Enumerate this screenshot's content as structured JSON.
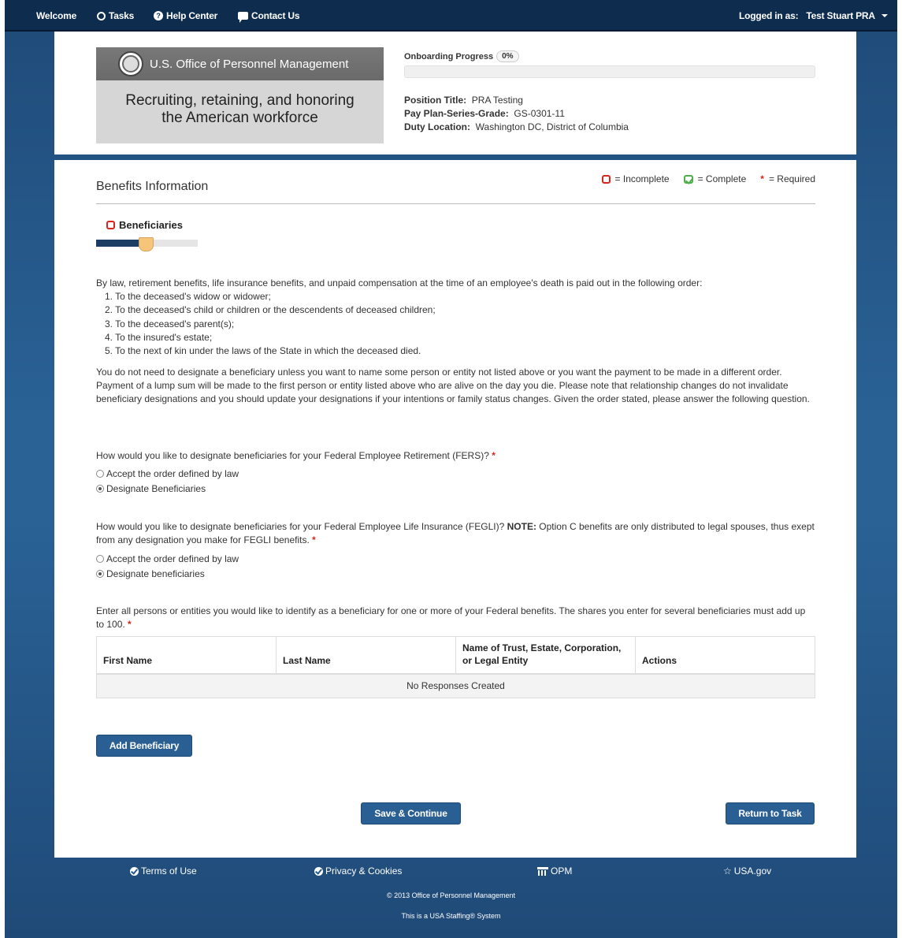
{
  "nav": {
    "welcome": "Welcome",
    "tasks": "Tasks",
    "help_center": "Help Center",
    "contact_us": "Contact Us",
    "logged_in_label": "Logged in as:",
    "user_name": "Test Stuart PRA"
  },
  "header": {
    "org_name": "U.S. Office of Personnel Management",
    "tagline_line1": "Recruiting, retaining, and honoring",
    "tagline_line2": "the American workforce",
    "progress_label": "Onboarding Progress",
    "progress_badge": "0%",
    "progress_value": 0,
    "position_title_label": "Position Title:",
    "position_title": "PRA Testing",
    "pay_plan_label": "Pay Plan-Series-Grade:",
    "pay_plan": "GS-0301-11",
    "duty_location_label": "Duty Location:",
    "duty_location": "Washington DC, District of Columbia"
  },
  "main": {
    "title": "Benefits Information",
    "legend": {
      "incomplete": "= Incomplete",
      "complete": "= Complete",
      "required_star": "*",
      "required": "= Required"
    },
    "section_title": "Beneficiaries",
    "stepper_progress": 0.45,
    "intro": "By law, retirement benefits, life insurance benefits, and unpaid compensation at the time of an employee's death is paid out in the following order:",
    "order": [
      "1. To the deceased's widow or widower;",
      "2. To the deceased's child or children or the descendents of deceased children;",
      "3. To the deceased's parent(s);",
      "4. To the insured's estate;",
      "5. To the next of kin under the laws of the State in which the deceased died."
    ],
    "explanation": "You do not need to designate a beneficiary unless you want to name some person or entity not listed above or you want the payment to be made in a different order. Payment of a lump sum will be made to the first person or entity listed above who are alive on the day you die. Please note that relationship changes do not invalidate beneficiary designations and you should update your designations if your intentions or family status changes. Given the order stated, please answer the following question.",
    "q_fers": "How would you like to designate beneficiaries for your Federal Employee Retirement (FERS)?",
    "q_fers_opt1": "Accept the order defined by law",
    "q_fers_opt2": "Designate Beneficiaries",
    "q_fegli_pre": "How would you like to designate beneficiaries for your Federal Employee Life Insurance (FEGLI)?",
    "q_fegli_note": "NOTE:",
    "q_fegli_post": "Option C benefits are only distributed to legal spouses, thus exept from any designation you make for FEGLI benefits.",
    "q_fegli_opt1": "Accept the order defined by law",
    "q_fegli_opt2": "Designate beneficiaries",
    "q_entries": "Enter all persons or entities you would like to identify as a beneficiary for one or more of your Federal benefits. The shares you enter for several beneficiaries must add up to 100.",
    "required_star": "*",
    "table": {
      "headers": [
        "First Name",
        "Last Name",
        "Name of Trust, Estate, Corporation, or Legal Entity",
        "Actions"
      ],
      "empty": "No Responses Created"
    },
    "add_button": "Add Beneficiary",
    "save_button": "Save & Continue",
    "return_button": "Return to Task"
  },
  "footer": {
    "terms": "Terms of Use",
    "privacy": "Privacy & Cookies",
    "opm": "OPM",
    "usa": "USA.gov",
    "copyright": "© 2013 Office of Personnel Management",
    "system": "This is a USA Staffing® System"
  },
  "colors": {
    "nav_bg": "#0d2c4e",
    "page_bg": "#2a6296",
    "button": "#2a5f94",
    "incomplete": "#d9261c",
    "complete": "#4cae4c",
    "stepper_fill": "#1c3d63",
    "stepper_knob": "#f7c57a"
  }
}
